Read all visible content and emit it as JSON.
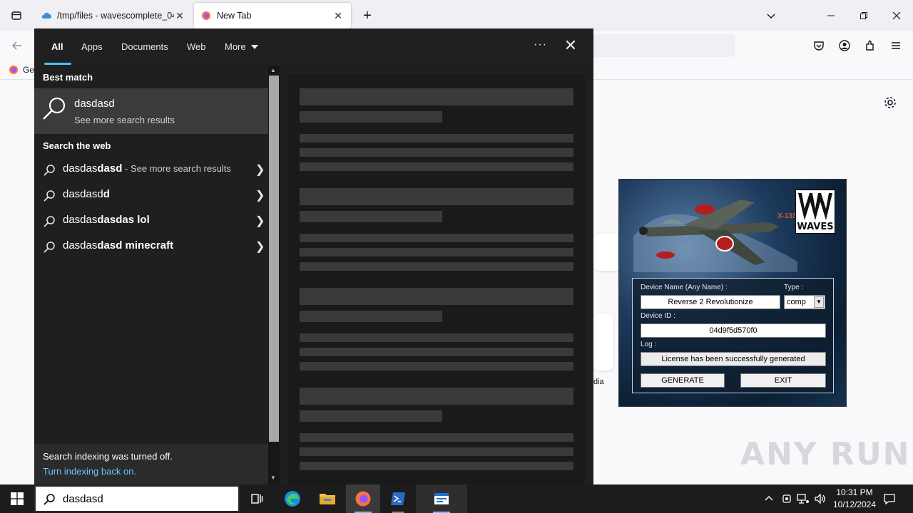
{
  "browser": {
    "tabs": [
      {
        "title": "/tmp/files - wavescomplete_04",
        "close": "✕"
      },
      {
        "title": "New Tab",
        "close": "✕"
      }
    ],
    "new_tab": "+",
    "bookmark_label": "Get"
  },
  "search_flyout": {
    "tabs": [
      "All",
      "Apps",
      "Documents",
      "Web",
      "More"
    ],
    "more_options": "···",
    "close": "✕",
    "best_match_heading": "Best match",
    "best_match": {
      "title": "dasdasd",
      "subtitle": "See more search results"
    },
    "web_heading": "Search the web",
    "web_results": [
      {
        "prefix": "dasdas",
        "bold": "dasd",
        "suffix": " - See more search results"
      },
      {
        "prefix": "dasdasd",
        "bold": "d",
        "suffix": ""
      },
      {
        "prefix": "dasdas",
        "bold": "dasdas lol",
        "suffix": ""
      },
      {
        "prefix": "dasdas",
        "bold": "dasd minecraft",
        "suffix": ""
      }
    ],
    "footer_message": "Search indexing was turned off.",
    "footer_link": "Turn indexing back on."
  },
  "keygen": {
    "logo_text": "WAVES",
    "plane_marking": "X-133",
    "device_name_label": "Device Name (Any Name) :",
    "device_name_value": "Reverse 2 Revolutionize",
    "type_label": "Type :",
    "type_value": "comp",
    "device_id_label": "Device ID :",
    "device_id_value": "04d9f5d570f0",
    "log_label": "Log :",
    "log_value": "License has been successfully generated",
    "generate_button": "GENERATE",
    "exit_button": "EXIT"
  },
  "page": {
    "partial_shortcut_label": "dia",
    "watermark": "ANY RUN"
  },
  "taskbar": {
    "search_value": "dasdasd",
    "time": "10:31 PM",
    "date": "10/12/2024"
  },
  "colors": {
    "accent_blue": "#4cc2ff",
    "link_blue": "#6cc6ff",
    "flyout_bg": "#1f1f1f",
    "taskbar_bg": "#1c1c1c"
  }
}
